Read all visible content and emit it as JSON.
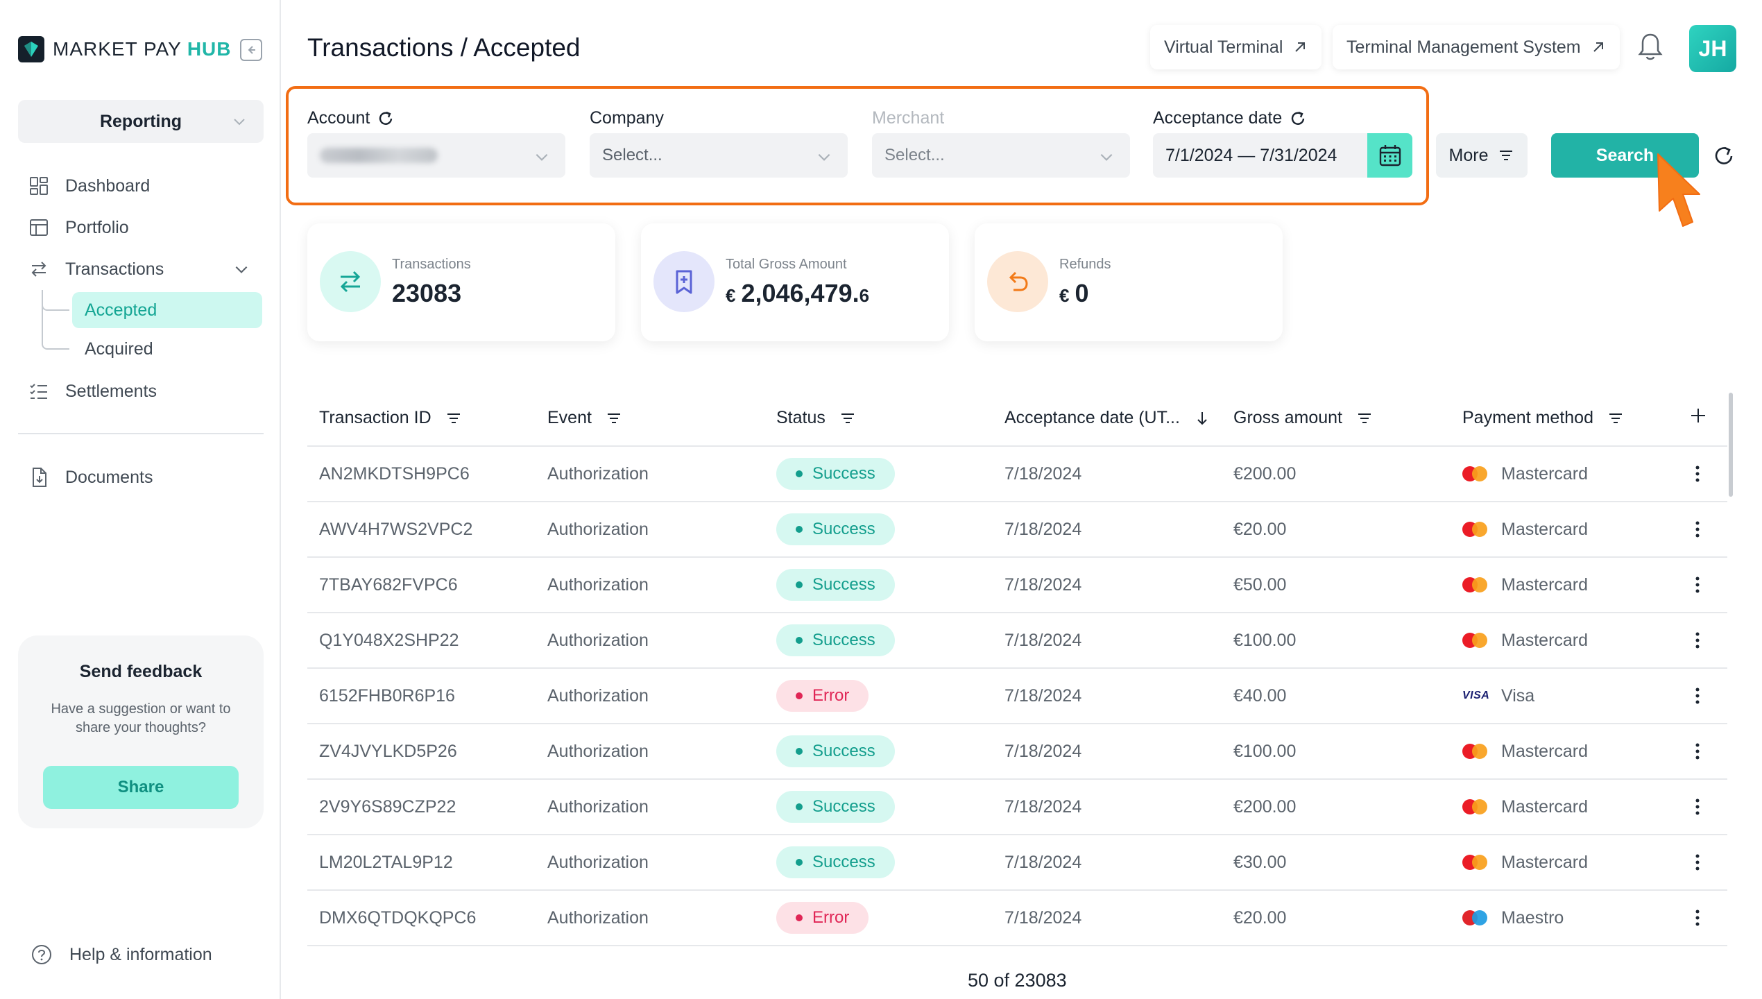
{
  "brand": {
    "name": "MARKET PAY",
    "hub": "HUB"
  },
  "sidebar": {
    "section": "Reporting",
    "items": [
      {
        "label": "Dashboard",
        "icon": "dashboard-icon"
      },
      {
        "label": "Portfolio",
        "icon": "portfolio-icon"
      },
      {
        "label": "Transactions",
        "icon": "transactions-icon"
      },
      {
        "label": "Settlements",
        "icon": "settlements-icon"
      },
      {
        "label": "Documents",
        "icon": "documents-icon"
      }
    ],
    "sub_items": [
      {
        "label": "Accepted",
        "active": true
      },
      {
        "label": "Acquired",
        "active": false
      }
    ],
    "feedback": {
      "title": "Send feedback",
      "text": "Have a suggestion or want to share your thoughts?",
      "button": "Share"
    },
    "help": "Help & information"
  },
  "header": {
    "title": "Transactions / Accepted",
    "links": [
      "Virtual Terminal",
      "Terminal Management System"
    ],
    "avatar": "JH"
  },
  "filters": {
    "account": {
      "label": "Account",
      "value": ""
    },
    "company": {
      "label": "Company",
      "placeholder": "Select..."
    },
    "merchant": {
      "label": "Merchant",
      "placeholder": "Select...",
      "disabled": true
    },
    "date": {
      "label": "Acceptance date",
      "value": "7/1/2024 — 7/31/2024"
    },
    "more": "More",
    "search": "Search"
  },
  "stats": [
    {
      "label": "Transactions",
      "value": "23083",
      "currency": "",
      "decimal": ""
    },
    {
      "label": "Total Gross Amount",
      "value": "2,046,479.",
      "currency": "€",
      "decimal": "6"
    },
    {
      "label": "Refunds",
      "value": "0",
      "currency": "€",
      "decimal": ""
    }
  ],
  "table": {
    "columns": [
      "Transaction ID",
      "Event",
      "Status",
      "Acceptance date (UT...",
      "Gross amount",
      "Payment method"
    ],
    "rows": [
      {
        "id": "AN2MKDTSH9PC6",
        "event": "Authorization",
        "status": "Success",
        "date": "7/18/2024",
        "amount": "€200.00",
        "method": "Mastercard"
      },
      {
        "id": "AWV4H7WS2VPC2",
        "event": "Authorization",
        "status": "Success",
        "date": "7/18/2024",
        "amount": "€20.00",
        "method": "Mastercard"
      },
      {
        "id": "7TBAY682FVPC6",
        "event": "Authorization",
        "status": "Success",
        "date": "7/18/2024",
        "amount": "€50.00",
        "method": "Mastercard"
      },
      {
        "id": "Q1Y048X2SHP22",
        "event": "Authorization",
        "status": "Success",
        "date": "7/18/2024",
        "amount": "€100.00",
        "method": "Mastercard"
      },
      {
        "id": "6152FHB0R6P16",
        "event": "Authorization",
        "status": "Error",
        "date": "7/18/2024",
        "amount": "€40.00",
        "method": "Visa"
      },
      {
        "id": "ZV4JVYLKD5P26",
        "event": "Authorization",
        "status": "Success",
        "date": "7/18/2024",
        "amount": "€100.00",
        "method": "Mastercard"
      },
      {
        "id": "2V9Y6S89CZP22",
        "event": "Authorization",
        "status": "Success",
        "date": "7/18/2024",
        "amount": "€200.00",
        "method": "Mastercard"
      },
      {
        "id": "LM20L2TAL9P12",
        "event": "Authorization",
        "status": "Success",
        "date": "7/18/2024",
        "amount": "€30.00",
        "method": "Mastercard"
      },
      {
        "id": "DMX6QTDQKQPC6",
        "event": "Authorization",
        "status": "Error",
        "date": "7/18/2024",
        "amount": "€20.00",
        "method": "Maestro"
      }
    ],
    "pagination": "50 of 23083"
  },
  "colors": {
    "accent": "#22b3a6",
    "highlight": "#f26d13",
    "success": "#139e8d",
    "error": "#e02656"
  }
}
